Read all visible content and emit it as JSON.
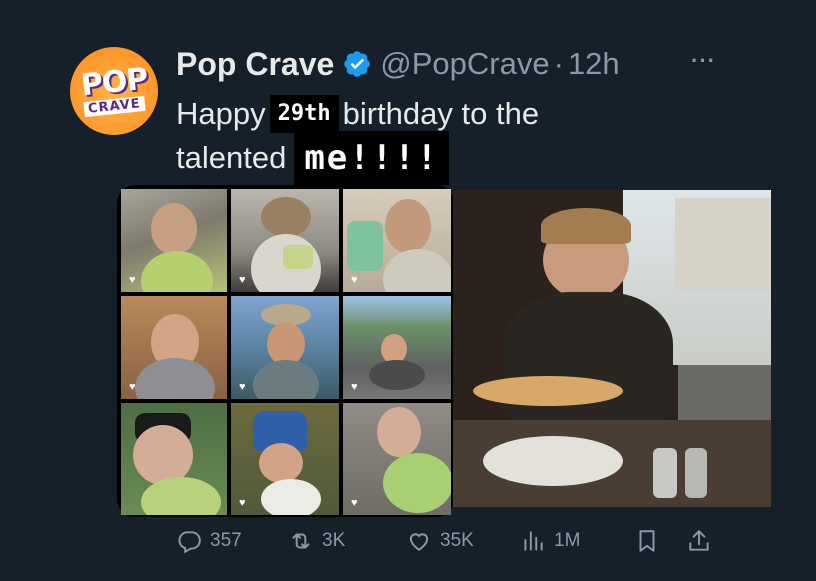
{
  "post": {
    "display_name": "Pop Crave",
    "handle": "@PopCrave",
    "separator": "·",
    "time": "12h",
    "more": "···",
    "avatar": {
      "top": "POP",
      "bottom": "CRAVE"
    },
    "text_line1_prefix": "Happy",
    "sticker_age": "29th",
    "text_line1_suffix": "birthday to the",
    "text_line2_prefix": "talented",
    "sticker_me": "me!!!!"
  },
  "actions": {
    "replies": "357",
    "reposts": "3K",
    "likes": "35K",
    "views": "1M"
  },
  "colors": {
    "background": "#15202b",
    "verified": "#1d9bf0",
    "muted": "#8b98a5",
    "accent_orange": "#ff9a2e"
  },
  "icons": [
    "verified-badge-icon",
    "more-icon",
    "reply-icon",
    "repost-icon",
    "like-icon",
    "views-icon",
    "bookmark-icon",
    "share-icon",
    "heart-icon"
  ]
}
